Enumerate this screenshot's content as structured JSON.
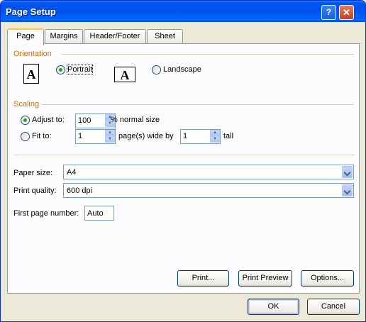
{
  "window": {
    "title": "Page Setup",
    "help_glyph": "?",
    "close_glyph": "✕"
  },
  "tabs": [
    {
      "label": "Page"
    },
    {
      "label": "Margins"
    },
    {
      "label": "Header/Footer"
    },
    {
      "label": "Sheet"
    }
  ],
  "orientation": {
    "label": "Orientation",
    "portrait": {
      "label": "Portrait",
      "checked": true,
      "icon_glyph": "A"
    },
    "landscape": {
      "label": "Landscape",
      "checked": false,
      "icon_glyph": "A"
    }
  },
  "scaling": {
    "label": "Scaling",
    "adjust_to": {
      "label": "Adjust to:",
      "checked": true,
      "value": "100",
      "suffix": "% normal size"
    },
    "fit_to": {
      "label": "Fit to:",
      "checked": false,
      "wide_value": "1",
      "wide_suffix": "page(s) wide by",
      "tall_value": "1",
      "tall_suffix": "tall"
    }
  },
  "paper_size": {
    "label": "Paper size:",
    "value": "A4"
  },
  "print_quality": {
    "label": "Print quality:",
    "value": "600 dpi"
  },
  "first_page_number": {
    "label": "First page number:",
    "value": "Auto"
  },
  "buttons": {
    "print": "Print...",
    "print_preview": "Print Preview",
    "options": "Options...",
    "ok": "OK",
    "cancel": "Cancel"
  },
  "colors": {
    "title_bar": "#0054e3",
    "group_label": "#e06b00",
    "dialog_bg": "#ece9d8"
  }
}
